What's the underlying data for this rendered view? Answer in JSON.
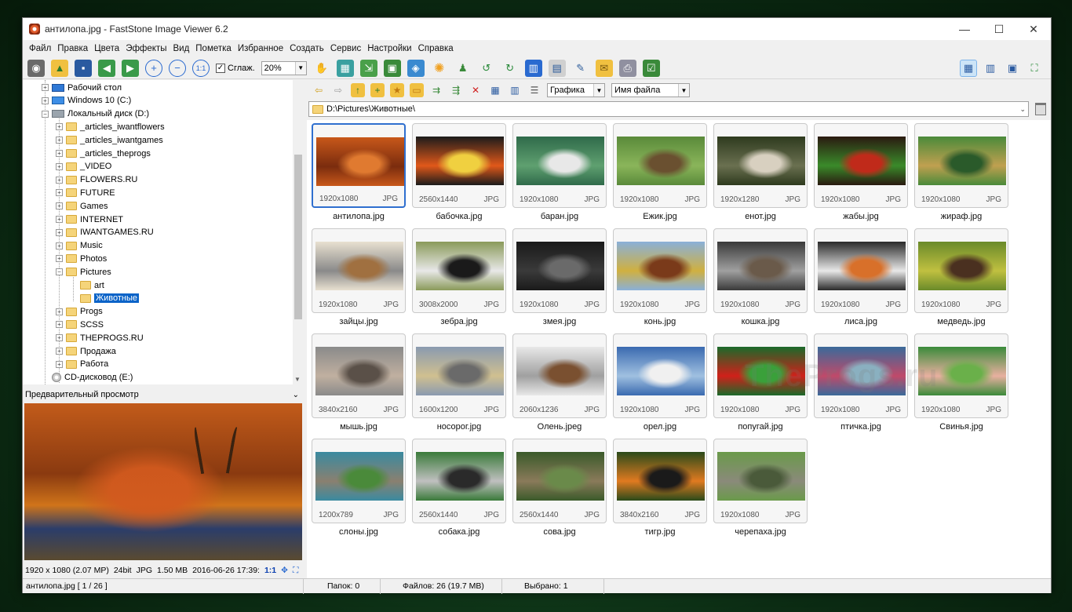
{
  "window": {
    "title": "антилопа.jpg  -  FastStone Image Viewer 6.2",
    "controls": [
      "—",
      "☐",
      "✕"
    ]
  },
  "menu": [
    "Файл",
    "Правка",
    "Цвета",
    "Эффекты",
    "Вид",
    "Пометка",
    "Избранное",
    "Создать",
    "Сервис",
    "Настройки",
    "Справка"
  ],
  "toolbar": {
    "smooth_label": "Сглаж.",
    "smooth_checked": "✓",
    "zoom_value": "20%",
    "view_filter_value": "Графика",
    "sort_value": "Имя файла"
  },
  "path": "D:\\Pictures\\Животные\\",
  "tree": {
    "items": [
      {
        "label": "Рабочий стол",
        "kind": "desktop"
      },
      {
        "label": "Windows 10 (C:)",
        "kind": "drive-win"
      },
      {
        "label": "Локальный диск (D:)",
        "kind": "drive"
      },
      {
        "label": "_articles_iwantflowers",
        "kind": "folder"
      },
      {
        "label": "_articles_iwantgames",
        "kind": "folder"
      },
      {
        "label": "_articles_theprogs",
        "kind": "folder"
      },
      {
        "label": "_VIDEO",
        "kind": "folder"
      },
      {
        "label": "FLOWERS.RU",
        "kind": "folder"
      },
      {
        "label": "FUTURE",
        "kind": "folder"
      },
      {
        "label": "Games",
        "kind": "folder"
      },
      {
        "label": "INTERNET",
        "kind": "folder"
      },
      {
        "label": "IWANTGAMES.RU",
        "kind": "folder"
      },
      {
        "label": "Music",
        "kind": "folder"
      },
      {
        "label": "Photos",
        "kind": "folder"
      },
      {
        "label": "Pictures",
        "kind": "folder"
      },
      {
        "label": "art",
        "kind": "folder"
      },
      {
        "label": "Животные",
        "kind": "folder"
      },
      {
        "label": "Progs",
        "kind": "folder"
      },
      {
        "label": "SCSS",
        "kind": "folder"
      },
      {
        "label": "THEPROGS.RU",
        "kind": "folder"
      },
      {
        "label": "Продажа",
        "kind": "folder"
      },
      {
        "label": "Работа",
        "kind": "folder"
      },
      {
        "label": "CD-дисковод (E:)",
        "kind": "cd"
      }
    ]
  },
  "preview": {
    "header": "Предварительный просмотр",
    "info_dims": "1920 x 1080 (2.07 MP)",
    "info_bits": "24bit",
    "info_type": "JPG",
    "info_size": "1.50 MB",
    "info_date": "2016-06-26 17:39:",
    "info_zoom": "1:1"
  },
  "thumbnails": [
    {
      "name": "антилопа.jpg",
      "dims": "1920x1080",
      "type": "JPG",
      "colors": [
        "#c8581a",
        "#7a2c0e",
        "#e07a30"
      ]
    },
    {
      "name": "бабочка.jpg",
      "dims": "2560x1440",
      "type": "JPG",
      "colors": [
        "#1b1b1b",
        "#e0581a",
        "#f0d040"
      ]
    },
    {
      "name": "баран.jpg",
      "dims": "1920x1080",
      "type": "JPG",
      "colors": [
        "#2f6a4a",
        "#5fa070",
        "#e8e8e8"
      ]
    },
    {
      "name": "Ежик.jpg",
      "dims": "1920x1080",
      "type": "JPG",
      "colors": [
        "#5a8a3a",
        "#8ab55a",
        "#6a5030"
      ]
    },
    {
      "name": "енот.jpg",
      "dims": "1920x1280",
      "type": "JPG",
      "colors": [
        "#2e3a1e",
        "#6a7050",
        "#d8d0c0"
      ]
    },
    {
      "name": "жабы.jpg",
      "dims": "1920x1080",
      "type": "JPG",
      "colors": [
        "#2a1a10",
        "#3a8a2a",
        "#c02a1a"
      ]
    },
    {
      "name": "жираф.jpg",
      "dims": "1920x1080",
      "type": "JPG",
      "colors": [
        "#4a8a3a",
        "#c0a050",
        "#2a5a2a"
      ]
    },
    {
      "name": "зайцы.jpg",
      "dims": "1920x1080",
      "type": "JPG",
      "colors": [
        "#e8e0d0",
        "#8a8a8a",
        "#a07040"
      ]
    },
    {
      "name": "зебра.jpg",
      "dims": "3008x2000",
      "type": "JPG",
      "colors": [
        "#8a9a5a",
        "#e8e8e8",
        "#1a1a1a"
      ]
    },
    {
      "name": "змея.jpg",
      "dims": "1920x1080",
      "type": "JPG",
      "colors": [
        "#1a1a1a",
        "#3a3a3a",
        "#6a6a6a"
      ]
    },
    {
      "name": "конь.jpg",
      "dims": "1920x1080",
      "type": "JPG",
      "colors": [
        "#8ab0d8",
        "#d0b040",
        "#7a3a1a"
      ]
    },
    {
      "name": "кошка.jpg",
      "dims": "1920x1080",
      "type": "JPG",
      "colors": [
        "#3a3a3a",
        "#a0a0a0",
        "#6a5a4a"
      ]
    },
    {
      "name": "лиса.jpg",
      "dims": "1920x1080",
      "type": "JPG",
      "colors": [
        "#2a2a2a",
        "#e8e8e8",
        "#d8702a"
      ]
    },
    {
      "name": "медведь.jpg",
      "dims": "1920x1080",
      "type": "JPG",
      "colors": [
        "#6a8a2a",
        "#c0c040",
        "#4a3020"
      ]
    },
    {
      "name": "мышь.jpg",
      "dims": "3840x2160",
      "type": "JPG",
      "colors": [
        "#8a8a8a",
        "#c0b0a0",
        "#5a5048"
      ]
    },
    {
      "name": "носорог.jpg",
      "dims": "1600x1200",
      "type": "JPG",
      "colors": [
        "#8a9ab0",
        "#d0c090",
        "#6a6a6a"
      ]
    },
    {
      "name": "Олень.jpeg",
      "dims": "2060x1236",
      "type": "JPG",
      "colors": [
        "#e8e8e8",
        "#a0a0a0",
        "#7a5030"
      ]
    },
    {
      "name": "орел.jpg",
      "dims": "1920x1080",
      "type": "JPG",
      "colors": [
        "#3a6ab0",
        "#a0c0e0",
        "#f0f0f0"
      ]
    },
    {
      "name": "попугай.jpg",
      "dims": "1920x1080",
      "type": "JPG",
      "colors": [
        "#1a6a2a",
        "#d0201a",
        "#3aa03a"
      ]
    },
    {
      "name": "птичка.jpg",
      "dims": "1920x1080",
      "type": "JPG",
      "colors": [
        "#3a6a9a",
        "#c04a6a",
        "#8ab0c0"
      ]
    },
    {
      "name": "Свинья.jpg",
      "dims": "1920x1080",
      "type": "JPG",
      "colors": [
        "#3a8a3a",
        "#e8b0a0",
        "#6ab04a"
      ]
    },
    {
      "name": "слоны.jpg",
      "dims": "1200x789",
      "type": "JPG",
      "colors": [
        "#3a8aa0",
        "#8a8070",
        "#4a8a3a"
      ]
    },
    {
      "name": "собака.jpg",
      "dims": "2560x1440",
      "type": "JPG",
      "colors": [
        "#3a7a3a",
        "#c0c0c0",
        "#2a2a2a"
      ]
    },
    {
      "name": "сова.jpg",
      "dims": "2560x1440",
      "type": "JPG",
      "colors": [
        "#3a5a2a",
        "#8a7a5a",
        "#6a8a4a"
      ]
    },
    {
      "name": "тигр.jpg",
      "dims": "3840x2160",
      "type": "JPG",
      "colors": [
        "#2a4a1a",
        "#e07a20",
        "#1a1a1a"
      ]
    },
    {
      "name": "черепаха.jpg",
      "dims": "1920x1080",
      "type": "JPG",
      "colors": [
        "#6a9a4a",
        "#8a8a7a",
        "#4a5a3a"
      ]
    }
  ],
  "status": {
    "file": "антилопа.jpg [ 1 / 26 ]",
    "folders": "Папок: 0",
    "files": "Файлов: 26 (19.7 MB)",
    "selected": "Выбрано: 1"
  },
  "watermark": "TheProgs.ru"
}
